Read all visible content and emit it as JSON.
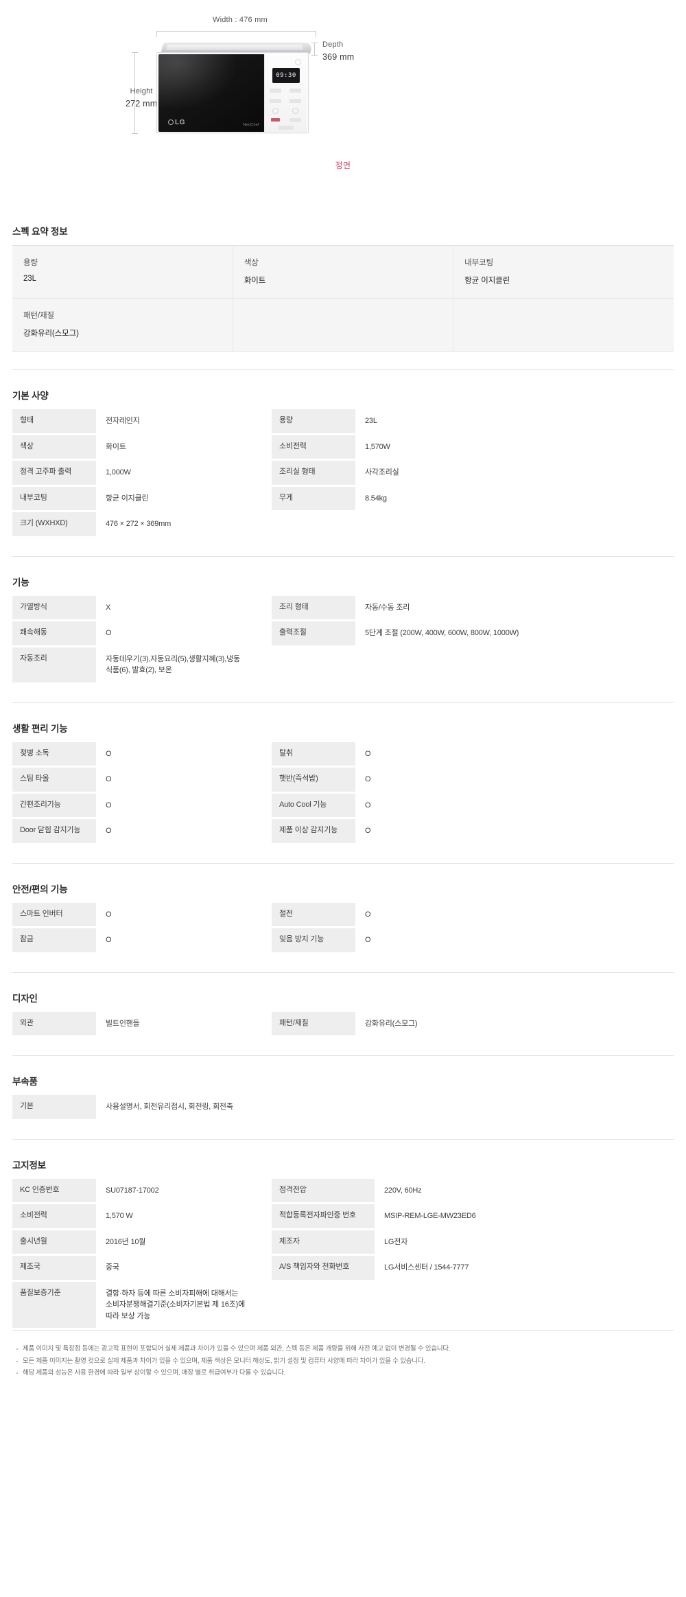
{
  "diagram": {
    "width_label": "Width : 476 mm",
    "depth_label_line1": "Depth",
    "depth_label_line2": "369 mm",
    "height_label_line1": "Height",
    "height_label_line2": "272 mm",
    "front_caption": "정면",
    "display_text": "09:30",
    "brand": "LG",
    "brandmark": "NeoChef",
    "accent_color": "#d6486b"
  },
  "summary": {
    "title": "스펙 요약 정보",
    "cells": [
      {
        "key": "용량",
        "value": "23L"
      },
      {
        "key": "색상",
        "value": "화이트"
      },
      {
        "key": "내부코팅",
        "value": "항균 이지클린"
      },
      {
        "key": "패턴/재질",
        "value": "강화유리(스모그)"
      },
      {
        "key": "",
        "value": ""
      },
      {
        "key": "",
        "value": ""
      }
    ]
  },
  "basic_spec": {
    "title": "기본 사양",
    "rows": [
      {
        "l_key": "형태",
        "l_val": "전자레인지",
        "r_key": "용량",
        "r_val": "23L"
      },
      {
        "l_key": "색상",
        "l_val": "화이트",
        "r_key": "소비전력",
        "r_val": "1,570W"
      },
      {
        "l_key": "정격 고주파 출력",
        "l_val": "1,000W",
        "r_key": "조리실 형태",
        "r_val": "사각조리실"
      },
      {
        "l_key": "내부코팅",
        "l_val": "항균 이지클린",
        "r_key": "무게",
        "r_val": "8.54kg"
      },
      {
        "l_key": "크기 (WXHXD)",
        "l_val": "476 × 272 × 369mm",
        "r_key": "",
        "r_val": ""
      }
    ]
  },
  "function": {
    "title": "기능",
    "rows": [
      {
        "l_key": "가열방식",
        "l_val": "X",
        "r_key": "조리 형태",
        "r_val": "자동/수동 조리"
      },
      {
        "l_key": "쾌속해동",
        "l_val": "O",
        "r_key": "출력조절",
        "r_val": "5단계 조절 (200W, 400W, 600W, 800W, 1000W)"
      },
      {
        "l_key": "자동조리",
        "l_val": "자동데우기(3),자동요리(5),생활지혜(3),냉동식품(6), 발효(2), 보온",
        "r_key": "",
        "r_val": ""
      }
    ]
  },
  "convenience": {
    "title": "생활 편리 기능",
    "rows": [
      {
        "l_key": "젖병 소독",
        "l_val": "O",
        "r_key": "탈취",
        "r_val": "O"
      },
      {
        "l_key": "스팀 타올",
        "l_val": "O",
        "r_key": "햇반(즉석밥)",
        "r_val": "O"
      },
      {
        "l_key": "간편조리기능",
        "l_val": "O",
        "r_key": "Auto Cool 기능",
        "r_val": "O"
      },
      {
        "l_key": "Door 닫힘 감지기능",
        "l_val": "O",
        "r_key": "제품 이상 감지기능",
        "r_val": "O"
      }
    ]
  },
  "safety": {
    "title": "안전/편의 기능",
    "rows": [
      {
        "l_key": "스마트 인버터",
        "l_val": "O",
        "r_key": "절전",
        "r_val": "O"
      },
      {
        "l_key": "잠금",
        "l_val": "O",
        "r_key": "잊음 방지 기능",
        "r_val": "O"
      }
    ]
  },
  "design": {
    "title": "디자인",
    "rows": [
      {
        "l_key": "외관",
        "l_val": "빌트인핸들",
        "r_key": "패턴/재질",
        "r_val": "강화유리(스모그)"
      }
    ]
  },
  "accessories": {
    "title": "부속품",
    "rows": [
      {
        "l_key": "기본",
        "l_val": "사용설명서, 회전유리접시, 회전링, 회전축",
        "r_key": "",
        "r_val": ""
      }
    ]
  },
  "notice": {
    "title": "고지정보",
    "rows": [
      {
        "l_key": "KC 인증번호",
        "l_val": "SU07187-17002",
        "r_key": "정격전압",
        "r_val": "220V, 60Hz"
      },
      {
        "l_key": "소비전력",
        "l_val": "1,570 W",
        "r_key": "적합등록전자파인증 번호",
        "r_val": "MSIP-REM-LGE-MW23ED6"
      },
      {
        "l_key": "출시년월",
        "l_val": "2016년 10월",
        "r_key": "제조자",
        "r_val": "LG전자"
      },
      {
        "l_key": "제조국",
        "l_val": "중국",
        "r_key": "A/S 책임자와 전화번호",
        "r_val": "LG서비스센터 / 1544-7777"
      },
      {
        "l_key": "품질보증기준",
        "l_val": "결함·하자 등에 따른 소비자피해에 대해서는 소비자분쟁해결기준(소비자기본법 제 16조)에 따라 보상 가능",
        "r_key": "",
        "r_val": ""
      }
    ]
  },
  "notes": [
    "제품 이미지 및 특장점 등에는 광고적 표현이 포함되어 실제 제품과 차이가 있을 수 있으며 제품 외관, 스펙 등은 제품 개량을 위해 사전 예고 없이 변경될 수 있습니다.",
    "모든 제품 이미지는 촬영 컷으로 실제 제품과 차이가 있을 수 있으며, 제품 색상은 모니터 해상도, 밝기 설정 및 컴퓨터 사양에 따라 차이가 있을 수 있습니다.",
    "해당 제품의 성능은 사용 환경에 따라 일부 상이할 수 있으며, 매장 별로 취급여부가 다를 수 있습니다."
  ]
}
